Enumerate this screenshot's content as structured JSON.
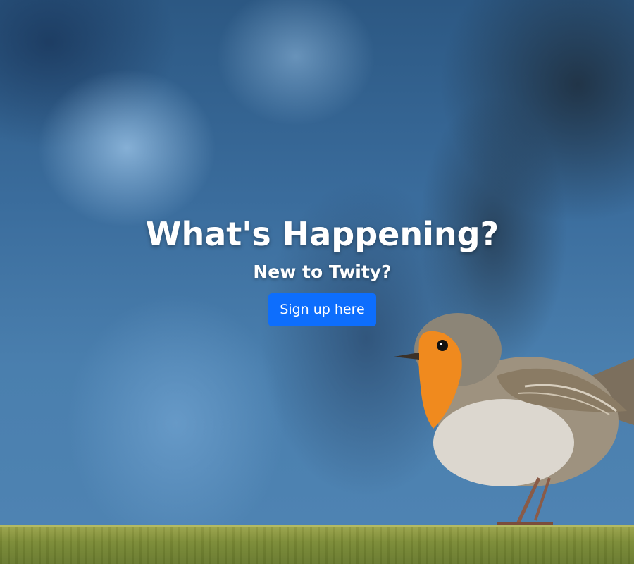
{
  "hero": {
    "title": "What's Happening?",
    "subtitle": "New to Twity?",
    "signup_label": "Sign up here",
    "background_image": "robin-on-branch-photo",
    "button_color": "#0d6efd",
    "text_color": "#ffffff"
  }
}
